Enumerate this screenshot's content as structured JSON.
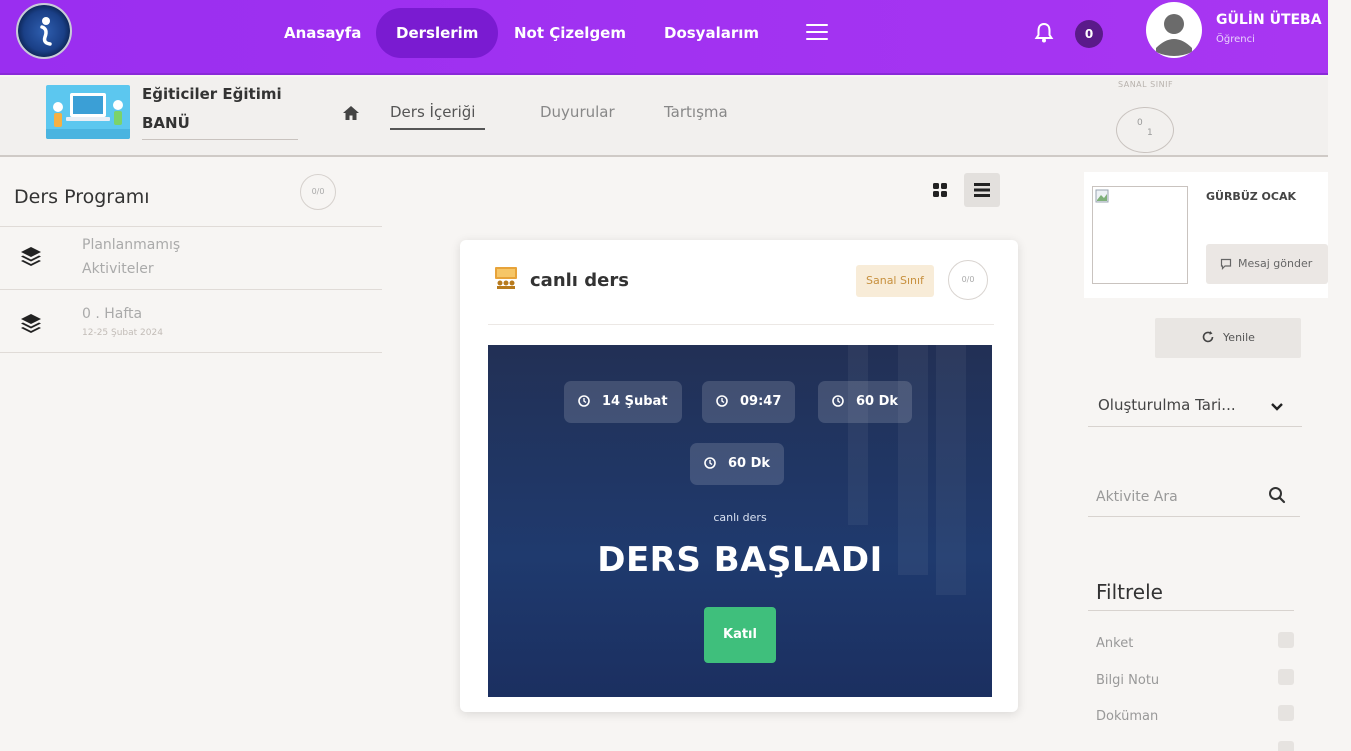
{
  "nav": {
    "items": [
      {
        "label": "Anasayfa",
        "active": false
      },
      {
        "label": "Derslerim",
        "active": true
      },
      {
        "label": "Not Çizelgem",
        "active": false
      },
      {
        "label": "Dosyalarım",
        "active": false
      }
    ],
    "notification_count": "0"
  },
  "user": {
    "name": "GÜLİN ÜTEBA",
    "role": "Öğrenci"
  },
  "course": {
    "title": "Eğiticiler Eğitimi",
    "subtitle": "BANÜ",
    "tabs": [
      {
        "label": "Ders İçeriği",
        "active": true
      },
      {
        "label": "Duyurular",
        "active": false
      },
      {
        "label": "Tartışma",
        "active": false
      }
    ],
    "sanal_label": "SANAL SINIF",
    "sanal_counts": {
      "top": "0",
      "bottom": "1"
    }
  },
  "sidebar": {
    "title": "Ders Programı",
    "counter": "0/0",
    "items": [
      {
        "line1": "Planlanmamış",
        "line2": "Aktiviteler",
        "date": ""
      },
      {
        "line1": "0 . Hafta",
        "line2": "",
        "date": "12-25 Şubat 2024"
      }
    ]
  },
  "card": {
    "title": "canlı ders",
    "badge": "Sanal Sınıf",
    "counter": "0/0",
    "pills": [
      "14 Şubat",
      "09:47",
      "60 Dk",
      "60 Dk"
    ],
    "banner_sub": "canlı ders",
    "banner_main": "DERS BAŞLADI",
    "join_label": "Katıl"
  },
  "right": {
    "tutor_name": "GÜRBÜZ OCAK",
    "message_label": "Mesaj gönder",
    "refresh_label": "Yenile",
    "sort_label": "Oluşturulma Tari...",
    "search_placeholder": "Aktivite Ara",
    "filter_title": "Filtrele",
    "filters": [
      "Anket",
      "Bilgi Notu",
      "Doküman"
    ]
  },
  "colors": {
    "topbar": "#9a2ef0",
    "nav_active": "#7a1bd1",
    "join_button": "#3fbf7c",
    "banner": "#1f3a6e",
    "badge_bg": "#f8ecd8",
    "badge_text": "#c7903e"
  }
}
